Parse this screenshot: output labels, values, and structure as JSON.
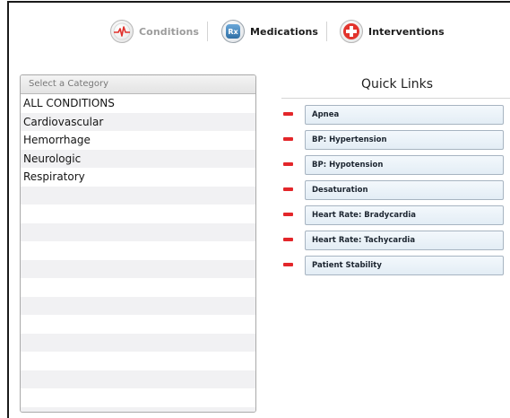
{
  "nav": {
    "items": [
      {
        "label": "Conditions",
        "icon": "heartbeat-icon",
        "state": "inactive"
      },
      {
        "label": "Medications",
        "icon": "rx-icon",
        "state": "active"
      },
      {
        "label": "Interventions",
        "icon": "medical-cross-icon",
        "state": "active"
      }
    ]
  },
  "category": {
    "header": "Select a Category",
    "items": [
      "ALL CONDITIONS",
      "Cardiovascular",
      "Hemorrhage",
      "Neurologic",
      "Respiratory"
    ]
  },
  "quick_links": {
    "title": "Quick Links",
    "items": [
      "Apnea",
      "BP: Hypertension",
      "BP: Hypotension",
      "Desaturation",
      "Heart Rate: Bradycardia",
      "Heart Rate: Tachycardia",
      "Patient Stability"
    ]
  },
  "colors": {
    "remove_accent": "#e3262a",
    "nav_inactive_text": "#9c9c9c",
    "cross_red": "#e2332c",
    "rx_blue": "#2f6fa5"
  }
}
